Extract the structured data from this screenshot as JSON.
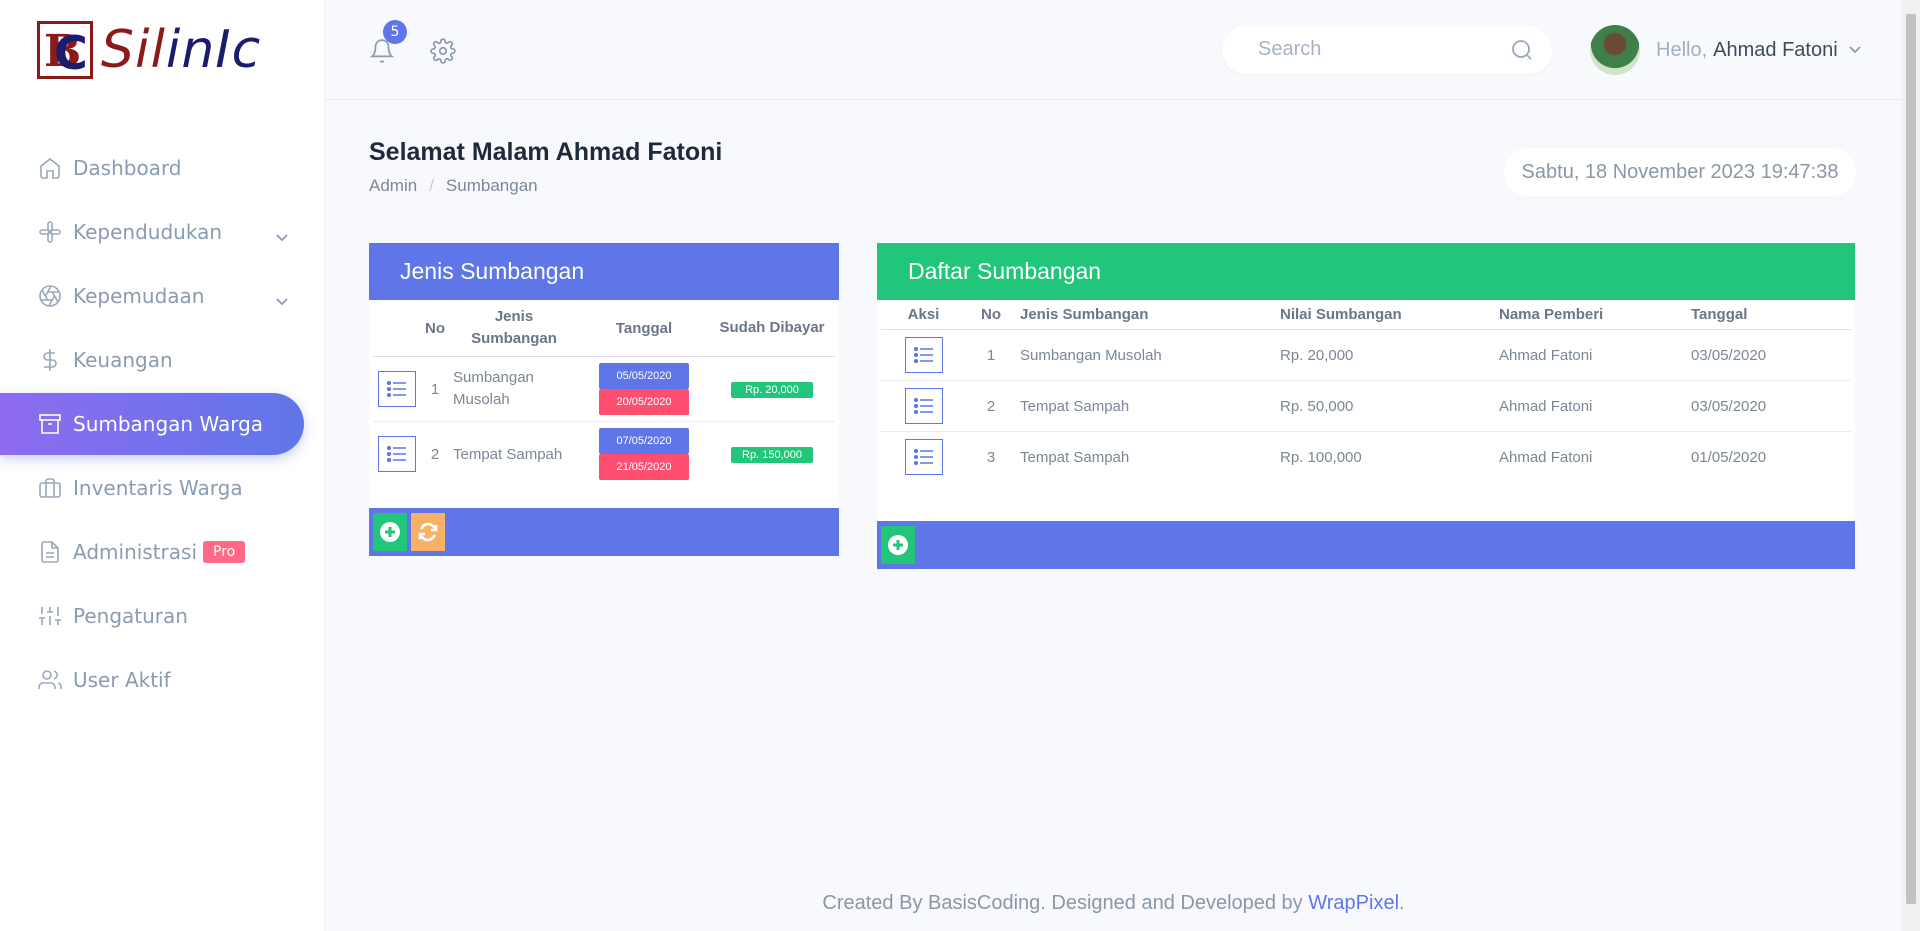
{
  "brand": {
    "logo_text": "SiIinIc"
  },
  "sidebar": {
    "items": [
      {
        "label": "Dashboard",
        "icon": "home-icon",
        "has_chevron": false
      },
      {
        "label": "Kependudukan",
        "icon": "slack-icon",
        "has_chevron": true
      },
      {
        "label": "Kepemudaan",
        "icon": "aperture-icon",
        "has_chevron": true
      },
      {
        "label": "Keuangan",
        "icon": "dollar-icon",
        "has_chevron": false
      },
      {
        "label": "Sumbangan Warga",
        "icon": "archive-icon",
        "has_chevron": false,
        "active": true
      },
      {
        "label": "Inventaris Warga",
        "icon": "briefcase-icon",
        "has_chevron": false
      },
      {
        "label": "Administrasi",
        "icon": "file-icon",
        "has_chevron": false,
        "badge": "Pro"
      },
      {
        "label": "Pengaturan",
        "icon": "sliders-icon",
        "has_chevron": false
      },
      {
        "label": "User Aktif",
        "icon": "users-icon",
        "has_chevron": false
      }
    ]
  },
  "topbar": {
    "notification_count": "5",
    "search_placeholder": "Search",
    "greeting": "Hello,",
    "user_name": "Ahmad Fatoni"
  },
  "page": {
    "title": "Selamat Malam Ahmad Fatoni",
    "breadcrumb": [
      "Admin",
      "Sumbangan"
    ],
    "datetime": "Sabtu, 18 November 2023 19:47:38"
  },
  "jenis": {
    "title": "Jenis Sumbangan",
    "headers": [
      "No",
      "Jenis Sumbangan",
      "Tanggal",
      "Sudah Dibayar"
    ],
    "rows": [
      {
        "no": "1",
        "jenis": "Sumbangan Musolah",
        "start": "05/05/2020",
        "end": "20/05/2020",
        "paid": "Rp. 20,000"
      },
      {
        "no": "2",
        "jenis": "Tempat Sampah",
        "start": "07/05/2020",
        "end": "21/05/2020",
        "paid": "Rp. 150,000"
      }
    ]
  },
  "daftar": {
    "title": "Daftar Sumbangan",
    "headers": [
      "Aksi",
      "No",
      "Jenis Sumbangan",
      "Nilai Sumbangan",
      "Nama Pemberi",
      "Tanggal"
    ],
    "rows": [
      {
        "no": "1",
        "jenis": "Sumbangan Musolah",
        "nilai": "Rp. 20,000",
        "pemberi": "Ahmad Fatoni",
        "tanggal": "03/05/2020"
      },
      {
        "no": "2",
        "jenis": "Tempat Sampah",
        "nilai": "Rp. 50,000",
        "pemberi": "Ahmad Fatoni",
        "tanggal": "03/05/2020"
      },
      {
        "no": "3",
        "jenis": "Tempat Sampah",
        "nilai": "Rp. 100,000",
        "pemberi": "Ahmad Fatoni",
        "tanggal": "01/05/2020"
      }
    ]
  },
  "footer": {
    "text": "Created By BasisCoding. Designed and Developed by ",
    "link": "WrapPixel",
    "end": "."
  },
  "colors": {
    "primary": "#5f76e8",
    "success": "#22c67a",
    "danger": "#ff4f70",
    "warning": "#f7b267"
  }
}
